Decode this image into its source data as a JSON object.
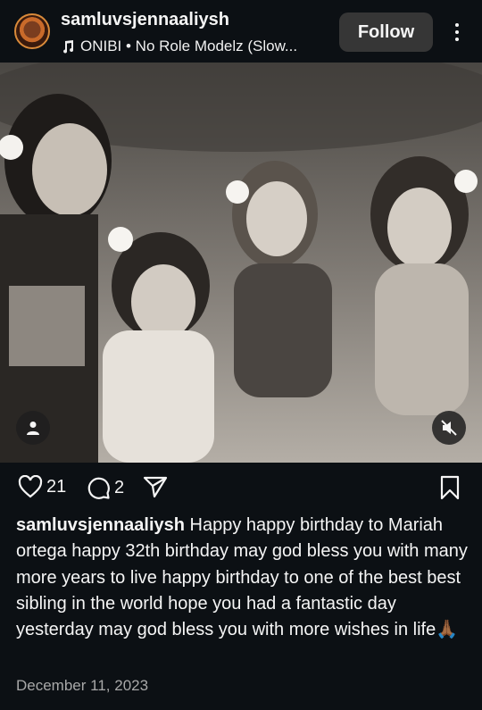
{
  "post": {
    "username": "samluvsjennaaliysh",
    "audio": "ONIBI • No Role Modelz (Slow...",
    "follow_label": "Follow",
    "likes": "21",
    "comments": "2",
    "caption_user": "samluvsjennaaliysh",
    "caption_text": "Happy happy birthday to Mariah ortega happy 32th birthday may god bless you with many more years to live happy birthday to one of the best best sibling in the world hope you had a fantastic day yesterday may god bless you with more wishes in life🙏🏾",
    "date": "December 11, 2023"
  },
  "icons": {
    "audio": "music-note-icon",
    "more": "more-vertical-icon",
    "tag": "person-tag-icon",
    "mute": "speaker-muted-icon",
    "like": "heart-icon",
    "comment": "comment-bubble-icon",
    "share": "paper-plane-icon",
    "save": "bookmark-icon"
  },
  "colors": {
    "background": "#0c1014",
    "follow_button": "#363636",
    "date_text": "#a8a8a8"
  }
}
